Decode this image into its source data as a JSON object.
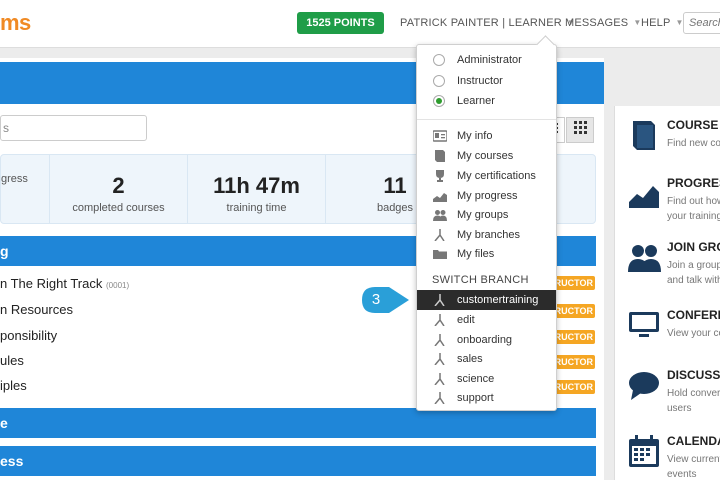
{
  "header": {
    "logo_text": "ms",
    "points_label": "1525 POINTS",
    "user_label": "PATRICK PAINTER | LEARNER",
    "messages_label": "MESSAGES",
    "help_label": "HELP",
    "search_placeholder": "Search"
  },
  "main": {
    "filter_placeholder": "s",
    "stats": [
      {
        "value": "",
        "label": "gress"
      },
      {
        "value": "2",
        "label": "completed courses"
      },
      {
        "value": "11h 47m",
        "label": "training time"
      },
      {
        "value": "11",
        "label": "badges"
      }
    ],
    "sections": [
      {
        "label": "g"
      },
      {
        "label": "e"
      },
      {
        "label": "ess"
      }
    ],
    "courses": [
      {
        "name": "n The Right Track",
        "code": "(0001)",
        "badge": "RUCTOR"
      },
      {
        "name": "n Resources",
        "code": "",
        "badge": "RUCTOR"
      },
      {
        "name": "ponsibility",
        "code": "",
        "badge": "RUCTOR"
      },
      {
        "name": "ules",
        "code": "",
        "badge": "RUCTOR"
      },
      {
        "name": "iples",
        "code": "",
        "badge": "RUCTOR"
      }
    ]
  },
  "sidepanel": {
    "items": [
      {
        "title": "COURSE C",
        "desc": [
          "Find new cou"
        ],
        "icon": "book-icon"
      },
      {
        "title": "PROGRESS",
        "desc": [
          "Find out how",
          "your training"
        ],
        "icon": "chart-icon"
      },
      {
        "title": "JOIN GROU",
        "desc": [
          "Join a group",
          "and talk with"
        ],
        "icon": "users-icon"
      },
      {
        "title": "CONFEREN",
        "desc": [
          "View your co"
        ],
        "icon": "monitor-icon"
      },
      {
        "title": "DISCUSSI",
        "desc": [
          "Hold convers",
          "users"
        ],
        "icon": "chat-icon"
      },
      {
        "title": "CALENDA",
        "desc": [
          "View current",
          "events"
        ],
        "icon": "calendar-icon"
      }
    ]
  },
  "dropdown": {
    "roles": [
      {
        "label": "Administrator",
        "selected": false
      },
      {
        "label": "Instructor",
        "selected": false
      },
      {
        "label": "Learner",
        "selected": true
      }
    ],
    "links": [
      {
        "label": "My info",
        "icon": "id-card-icon"
      },
      {
        "label": "My courses",
        "icon": "book-icon"
      },
      {
        "label": "My certifications",
        "icon": "trophy-icon"
      },
      {
        "label": "My progress",
        "icon": "chart-icon"
      },
      {
        "label": "My groups",
        "icon": "users-icon"
      },
      {
        "label": "My branches",
        "icon": "branch-icon"
      },
      {
        "label": "My files",
        "icon": "folder-icon"
      }
    ],
    "switch_branch_label": "SWITCH BRANCH",
    "branches": [
      {
        "label": "customertraining",
        "selected": true
      },
      {
        "label": "edit",
        "selected": false
      },
      {
        "label": "onboarding",
        "selected": false
      },
      {
        "label": "sales",
        "selected": false
      },
      {
        "label": "science",
        "selected": false
      },
      {
        "label": "support",
        "selected": false
      }
    ]
  },
  "callout": {
    "number": "3"
  },
  "colors": {
    "accent_blue": "#1f86d8",
    "points_green": "#1f9d48",
    "badge_orange": "#f5a623",
    "logo_orange": "#f08a24",
    "selected_dark": "#2b2b2b",
    "callout_blue": "#2a9fd8"
  }
}
